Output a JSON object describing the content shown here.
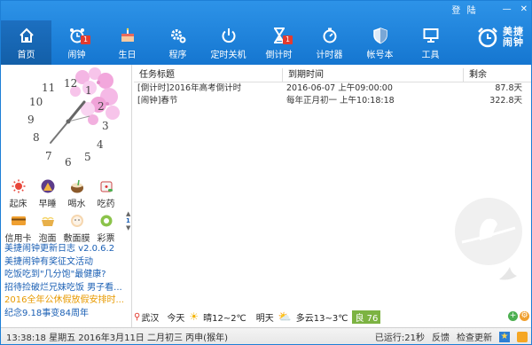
{
  "window": {
    "login_label": "登 陆",
    "minimize": "—",
    "close": "✕"
  },
  "nav": [
    {
      "label": "首页",
      "icon": "home-icon"
    },
    {
      "label": "闹钟",
      "icon": "alarm-clock-icon",
      "badge": "1"
    },
    {
      "label": "生日",
      "icon": "birthday-cake-icon"
    },
    {
      "label": "程序",
      "icon": "gears-icon"
    },
    {
      "label": "定时关机",
      "icon": "power-icon"
    },
    {
      "label": "倒计时",
      "icon": "hourglass-icon",
      "badge": "1"
    },
    {
      "label": "计时器",
      "icon": "stopwatch-icon"
    },
    {
      "label": "帐号本",
      "icon": "shield-icon"
    },
    {
      "label": "工具",
      "icon": "monitor-icon"
    }
  ],
  "brand": {
    "line1": "美捷",
    "line2": "闹钟"
  },
  "clock_numbers": [
    "12",
    "1",
    "2",
    "3",
    "4",
    "5",
    "6",
    "7",
    "8",
    "9",
    "10",
    "11"
  ],
  "apps": [
    {
      "label": "起床",
      "icon": "sun-icon"
    },
    {
      "label": "早睡",
      "icon": "tent-icon"
    },
    {
      "label": "喝水",
      "icon": "coconut-icon"
    },
    {
      "label": "吃药",
      "icon": "medicine-icon"
    },
    {
      "label": "信用卡",
      "icon": "credit-card-icon"
    },
    {
      "label": "泡面",
      "icon": "noodles-icon"
    },
    {
      "label": "敷面膜",
      "icon": "face-mask-icon"
    },
    {
      "label": "彩票",
      "icon": "lottery-icon"
    }
  ],
  "page_indicator": "1",
  "news": [
    {
      "text": "美捷闹钟更新日志 v2.0.6.2",
      "color": "#1a5fb4"
    },
    {
      "text": "美捷闹钟有奖征文活动",
      "color": "#1a5fb4"
    },
    {
      "text": "吃饭吃到\"几分饱\"最健康?",
      "color": "#1a5fb4"
    },
    {
      "text": "招待捡破烂兄妹吃饭 男子看...",
      "color": "#1a5fb4"
    },
    {
      "text": "2016全年公休假放假安排时...",
      "color": "#e89a00"
    },
    {
      "text": "纪念9.18事变84周年",
      "color": "#1a5fb4"
    }
  ],
  "table": {
    "headers": [
      "任务标题",
      "到期时间",
      "剩余"
    ],
    "rows": [
      {
        "title": "[倒计时]2016年高考倒计时",
        "due": "2016-06-07 上午09:00:00",
        "remain": "87.8天"
      },
      {
        "title": "[闹钟]春节",
        "due": "每年正月初一 上午10:18:18",
        "remain": "322.8天"
      }
    ]
  },
  "weather": {
    "city": "武汉",
    "today_label": "今天",
    "today": "晴12~2℃",
    "tomorrow_label": "明天",
    "tomorrow": "多云13~3℃",
    "aqi": "良 76"
  },
  "status": {
    "datetime": "13:38:18 星期五 2016年3月11日 二月初三 丙申(猴年)",
    "running": "已运行:21秒",
    "feedback": "反馈",
    "update": "检查更新"
  },
  "colors": {
    "accent": "#1576d0",
    "badge": "#e33b2f",
    "news_blue": "#1a5fb4",
    "news_orange": "#e89a00"
  }
}
